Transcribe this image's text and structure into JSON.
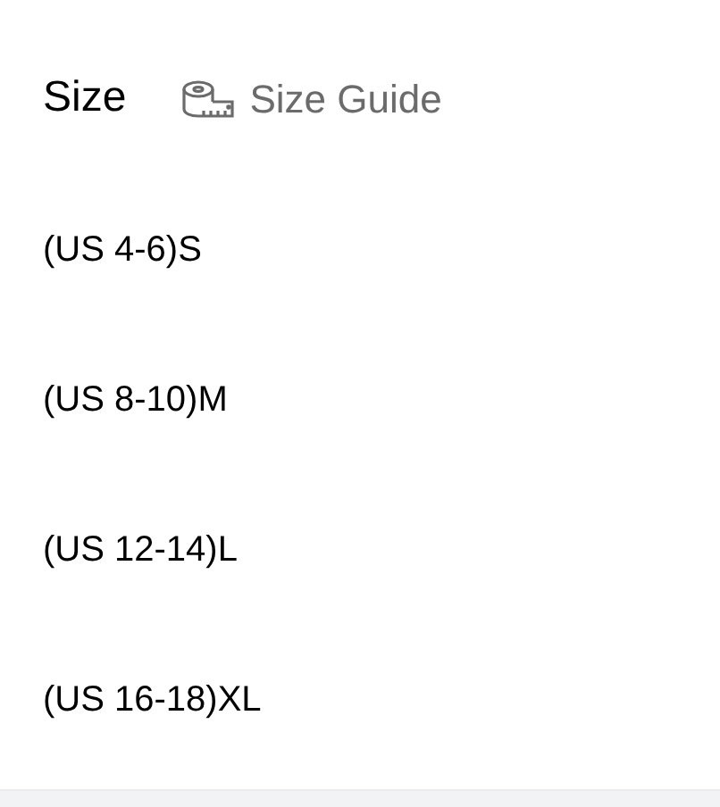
{
  "header": {
    "title": "Size",
    "guide_link": "Size Guide"
  },
  "options": [
    {
      "label": "(US 4-6)S"
    },
    {
      "label": "(US 8-10)M"
    },
    {
      "label": "(US 12-14)L"
    },
    {
      "label": "(US 16-18)XL"
    }
  ]
}
